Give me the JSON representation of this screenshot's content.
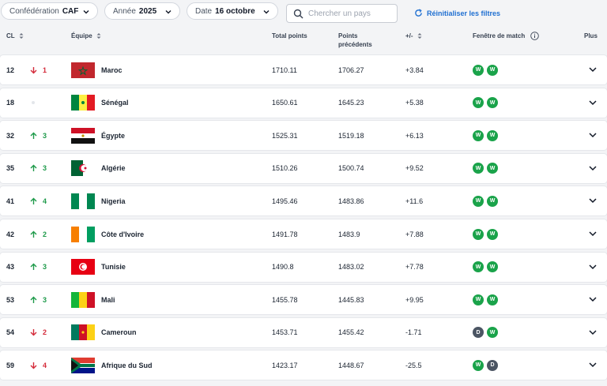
{
  "filters": {
    "confederation": {
      "label": "Confédération",
      "value": "CAF"
    },
    "year": {
      "label": "Année",
      "value": "2025"
    },
    "date": {
      "label": "Date",
      "value": "16 octobre"
    },
    "search_placeholder": "Chercher un pays",
    "reset_label": "Réinitialiser les filtres"
  },
  "columns": {
    "rank": "CL",
    "team": "Équipe",
    "total_points": "Total points",
    "previous_points": "Points précédents",
    "diff": "+/-",
    "match_window": "Fenêtre de match",
    "more": "Plus"
  },
  "colors": {
    "up": "#1e9a4a",
    "down": "#d42b3a",
    "win": "#1aa34a",
    "draw": "#4b5563",
    "accent": "#1f6fd1"
  },
  "rows": [
    {
      "rank": "12",
      "dir": "down",
      "move": "1",
      "team": "Maroc",
      "flag": "maroc-flag",
      "total": "1710.11",
      "prev": "1706.27",
      "diff": "+3.84",
      "form": [
        "W",
        "W"
      ]
    },
    {
      "rank": "18",
      "dir": "none",
      "move": "",
      "team": "Sénégal",
      "flag": "senegal-flag",
      "total": "1650.61",
      "prev": "1645.23",
      "diff": "+5.38",
      "form": [
        "W",
        "W"
      ]
    },
    {
      "rank": "32",
      "dir": "up",
      "move": "3",
      "team": "Égypte",
      "flag": "egypt-flag",
      "total": "1525.31",
      "prev": "1519.18",
      "diff": "+6.13",
      "form": [
        "W",
        "W"
      ]
    },
    {
      "rank": "35",
      "dir": "up",
      "move": "3",
      "team": "Algérie",
      "flag": "algeria-flag",
      "total": "1510.26",
      "prev": "1500.74",
      "diff": "+9.52",
      "form": [
        "W",
        "W"
      ]
    },
    {
      "rank": "41",
      "dir": "up",
      "move": "4",
      "team": "Nigeria",
      "flag": "nigeria-flag",
      "total": "1495.46",
      "prev": "1483.86",
      "diff": "+11.6",
      "form": [
        "W",
        "W"
      ]
    },
    {
      "rank": "42",
      "dir": "up",
      "move": "2",
      "team": "Côte d'Ivoire",
      "flag": "cotedivoire-flag",
      "total": "1491.78",
      "prev": "1483.9",
      "diff": "+7.88",
      "form": [
        "W",
        "W"
      ]
    },
    {
      "rank": "43",
      "dir": "up",
      "move": "3",
      "team": "Tunisie",
      "flag": "tunisia-flag",
      "total": "1490.8",
      "prev": "1483.02",
      "diff": "+7.78",
      "form": [
        "W",
        "W"
      ]
    },
    {
      "rank": "53",
      "dir": "up",
      "move": "3",
      "team": "Mali",
      "flag": "mali-flag",
      "total": "1455.78",
      "prev": "1445.83",
      "diff": "+9.95",
      "form": [
        "W",
        "W"
      ]
    },
    {
      "rank": "54",
      "dir": "down",
      "move": "2",
      "team": "Cameroun",
      "flag": "cameroon-flag",
      "total": "1453.71",
      "prev": "1455.42",
      "diff": "-1.71",
      "form": [
        "D",
        "W"
      ]
    },
    {
      "rank": "59",
      "dir": "down",
      "move": "4",
      "team": "Afrique du Sud",
      "flag": "southafrica-flag",
      "total": "1423.17",
      "prev": "1448.67",
      "diff": "-25.5",
      "form": [
        "W",
        "D"
      ]
    }
  ]
}
